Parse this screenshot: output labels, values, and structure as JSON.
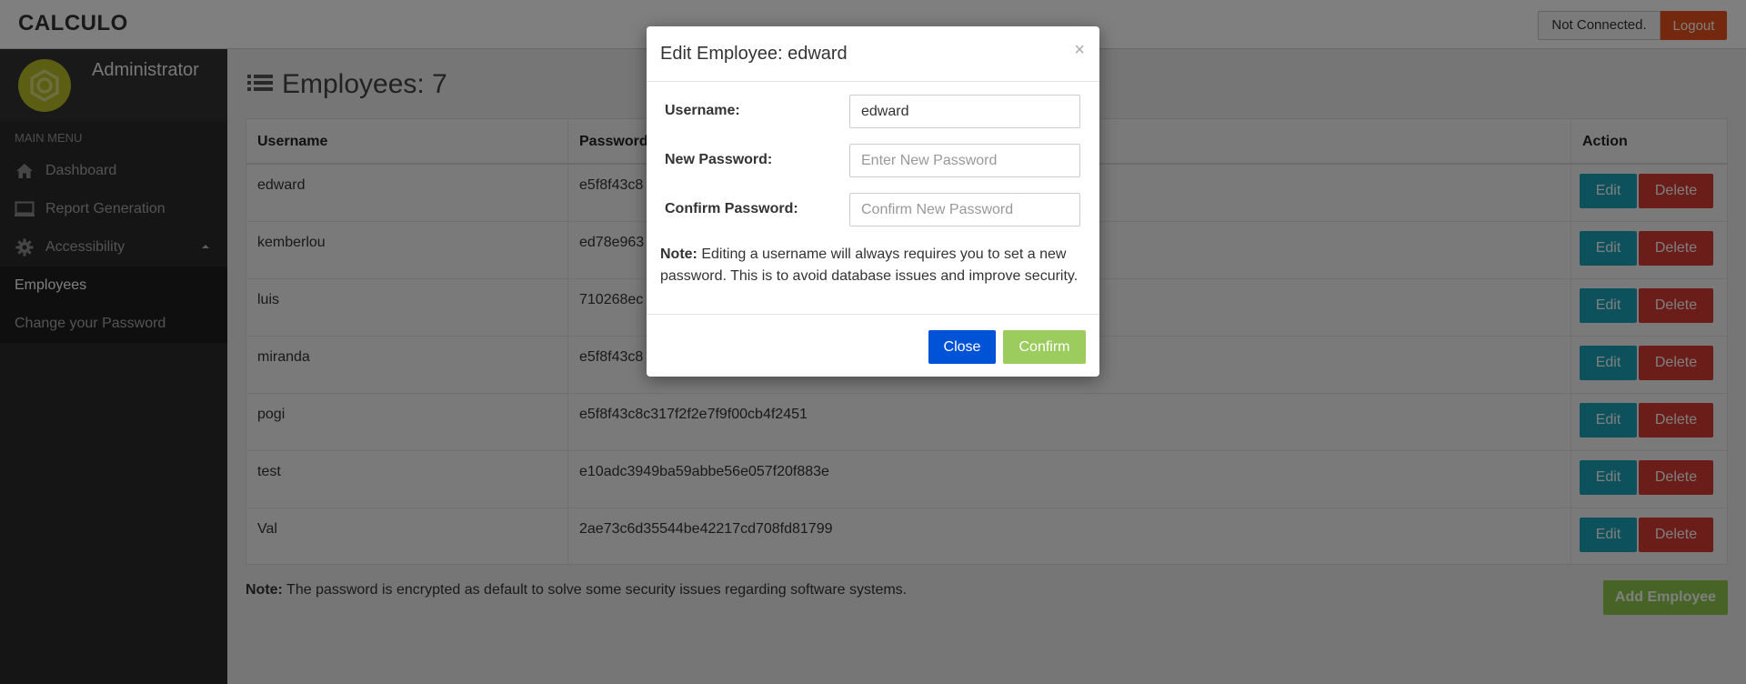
{
  "header": {
    "brand": "CALCULO",
    "connection_status": "Not Connected.",
    "logout_label": "Logout"
  },
  "sidebar": {
    "user_name": "Administrator",
    "menu_header": "MAIN MENU",
    "items": [
      {
        "label": "Dashboard",
        "icon": "home-icon"
      },
      {
        "label": "Report Generation",
        "icon": "monitor-icon"
      },
      {
        "label": "Accessibility",
        "icon": "gear-icon"
      }
    ],
    "sub_items": [
      {
        "label": "Employees",
        "active": true
      },
      {
        "label": "Change your Password",
        "active": false
      }
    ]
  },
  "main": {
    "title": "Employees: 7",
    "table": {
      "columns": [
        "Username",
        "Password",
        "Action"
      ],
      "rows": [
        {
          "username": "edward",
          "password": "e5f8f43c8"
        },
        {
          "username": "kemberlou",
          "password": "ed78e963"
        },
        {
          "username": "luis",
          "password": "710268ec"
        },
        {
          "username": "miranda",
          "password": "e5f8f43c8"
        },
        {
          "username": "pogi",
          "password": "e5f8f43c8c317f2f2e7f9f00cb4f2451"
        },
        {
          "username": "test",
          "password": "e10adc3949ba59abbe56e057f20f883e"
        },
        {
          "username": "Val",
          "password": "2ae73c6d35544be42217cd708fd81799"
        }
      ],
      "edit_label": "Edit",
      "delete_label": "Delete"
    },
    "note_prefix": "Note:",
    "note_text": " The password is encrypted as default to solve some security issues regarding software systems.",
    "add_employee_label": "Add Employee"
  },
  "modal": {
    "title": "Edit Employee: edward",
    "close_x": "×",
    "username_label": "Username:",
    "username_value": "edward",
    "new_password_label": "New Password:",
    "new_password_placeholder": "Enter New Password",
    "confirm_password_label": "Confirm Password:",
    "confirm_password_placeholder": "Confirm New Password",
    "note_prefix": "Note:",
    "note_text": " Editing a username will always requires you to set a new password. This is to avoid database issues and improve security.",
    "close_label": "Close",
    "confirm_label": "Confirm"
  },
  "colors": {
    "logout": "#e8531c",
    "edit": "#1aa3b8",
    "delete": "#d63b33",
    "add_employee": "#8fc74a",
    "modal_close": "#0052d6",
    "modal_confirm": "#9ccb5e",
    "avatar": "#b7bd27"
  }
}
